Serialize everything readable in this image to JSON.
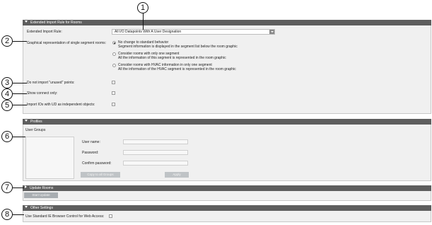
{
  "callouts": [
    "1",
    "2",
    "3",
    "4",
    "5",
    "6",
    "7",
    "8"
  ],
  "extended": {
    "header": "Extended Import Rule for Rooms",
    "rule_label": "Extended Import Rule:",
    "rule_value": "All I/O Datapoints With A User Designation",
    "graphical_label": "Graphical representation of single segment rooms:",
    "options": [
      {
        "title": "No change to standard behavior",
        "desc": "Segment information is displayed in the segment list below the room graphic",
        "selected": true
      },
      {
        "title": "Consider rooms with only one segment",
        "desc": "All the information of this segment is represented in the room graphic",
        "selected": false
      },
      {
        "title": "Consider rooms with HVAC information in only one segment",
        "desc": "All the information of the HVAC segment is represented in the room graphic",
        "selected": false
      }
    ],
    "unused_label": "Do not import \"unused\" points:",
    "connect_label": "Show connect only:",
    "ios_label": "Import IOs with UD as independent objects:"
  },
  "profiles": {
    "header": "Profiles",
    "groups_label": "User Groups",
    "username_label": "User name:",
    "password_label": "Password:",
    "confirm_label": "Confirm password:",
    "copy_button": "Copy to all Groups",
    "apply_button": "Apply"
  },
  "update": {
    "header": "Update Rooms",
    "start_button": "Start Update"
  },
  "other": {
    "header": "Other Settings",
    "ie_label": "Use Standard IE Browser Control for Web Access:"
  },
  "colors": {
    "header_bg": "#5e5e5e",
    "panel_bg": "#f0f0f0",
    "button_bg": "#bfc3c6"
  }
}
